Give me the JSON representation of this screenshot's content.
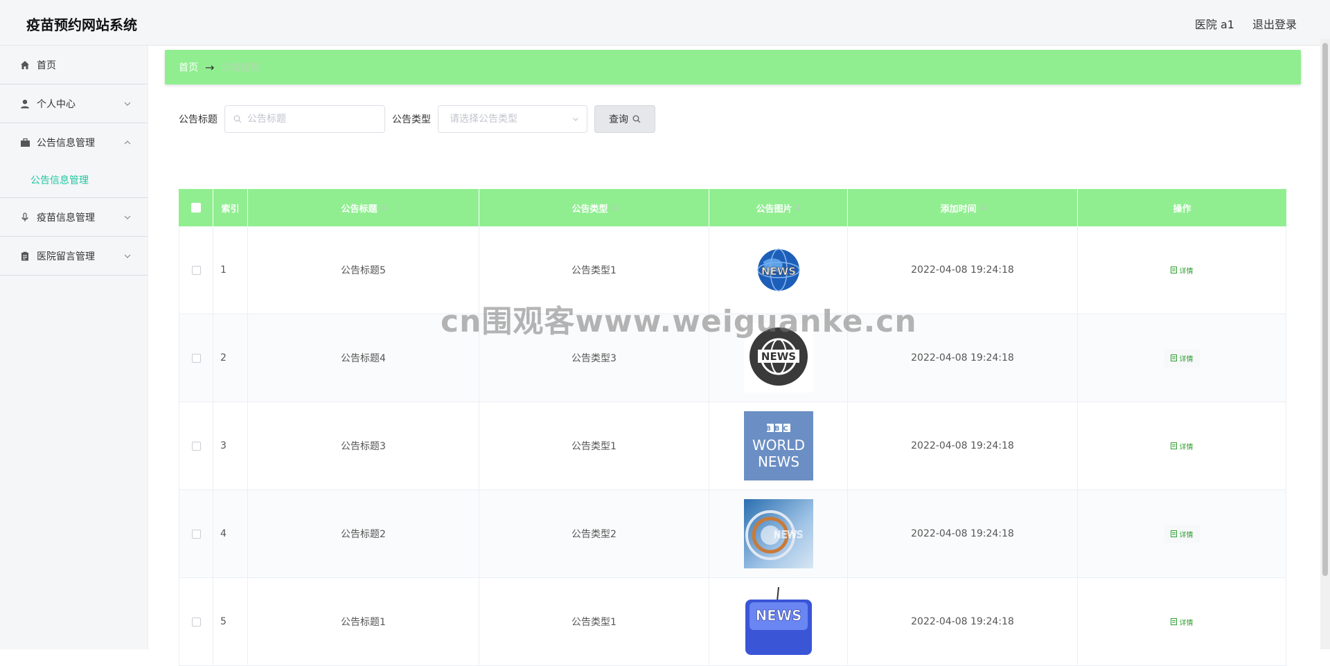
{
  "header": {
    "app_title": "疫苗预约网站系统",
    "user_label": "医院 a1",
    "logout_label": "退出登录"
  },
  "sidebar": {
    "items": [
      {
        "label": "首页",
        "icon": "home-icon"
      },
      {
        "label": "个人中心",
        "icon": "user-icon"
      },
      {
        "label": "公告信息管理",
        "icon": "briefcase-icon",
        "expanded": true,
        "children": [
          "公告信息管理"
        ]
      },
      {
        "label": "疫苗信息管理",
        "icon": "microphone-icon"
      },
      {
        "label": "医院留言管理",
        "icon": "clipboard-icon"
      }
    ]
  },
  "breadcrumb": {
    "home": "首页",
    "separator": "→",
    "current": "公告信息"
  },
  "search": {
    "title_label": "公告标题",
    "title_placeholder": "公告标题",
    "type_label": "公告类型",
    "type_placeholder": "请选择公告类型",
    "query_button": "查询"
  },
  "table": {
    "columns": [
      "索引",
      "公告标题",
      "公告类型",
      "公告图片",
      "添加时间",
      "操作"
    ],
    "rows": [
      {
        "index": "1",
        "title": "公告标题5",
        "type": "公告类型1",
        "image": "globe-news-image",
        "time": "2022-04-08 19:24:18",
        "action": "详情"
      },
      {
        "index": "2",
        "title": "公告标题4",
        "type": "公告类型3",
        "image": "news-badge-image",
        "time": "2022-04-08 19:24:18",
        "action": "详情"
      },
      {
        "index": "3",
        "title": "公告标题3",
        "type": "公告类型1",
        "image": "bbc-world-news-image",
        "time": "2022-04-08 19:24:18",
        "action": "详情"
      },
      {
        "index": "4",
        "title": "公告标题2",
        "type": "公告类型2",
        "image": "abstract-news-image",
        "time": "2022-04-08 19:24:18",
        "action": "详情"
      },
      {
        "index": "5",
        "title": "公告标题1",
        "type": "公告类型1",
        "image": "news-key-image",
        "time": "2022-04-08 19:24:18",
        "action": "详情"
      }
    ]
  },
  "images_text": {
    "bbc_logo": "BBC",
    "bbc_line1": "WORLD",
    "bbc_line2": "NEWS",
    "news_word": "NEWS"
  },
  "watermark": "cn围观客www.weiguanke.cn",
  "colors": {
    "accent_green": "#90ee90",
    "active_teal": "#20c7a0",
    "detail_green": "#2e9b2e"
  }
}
